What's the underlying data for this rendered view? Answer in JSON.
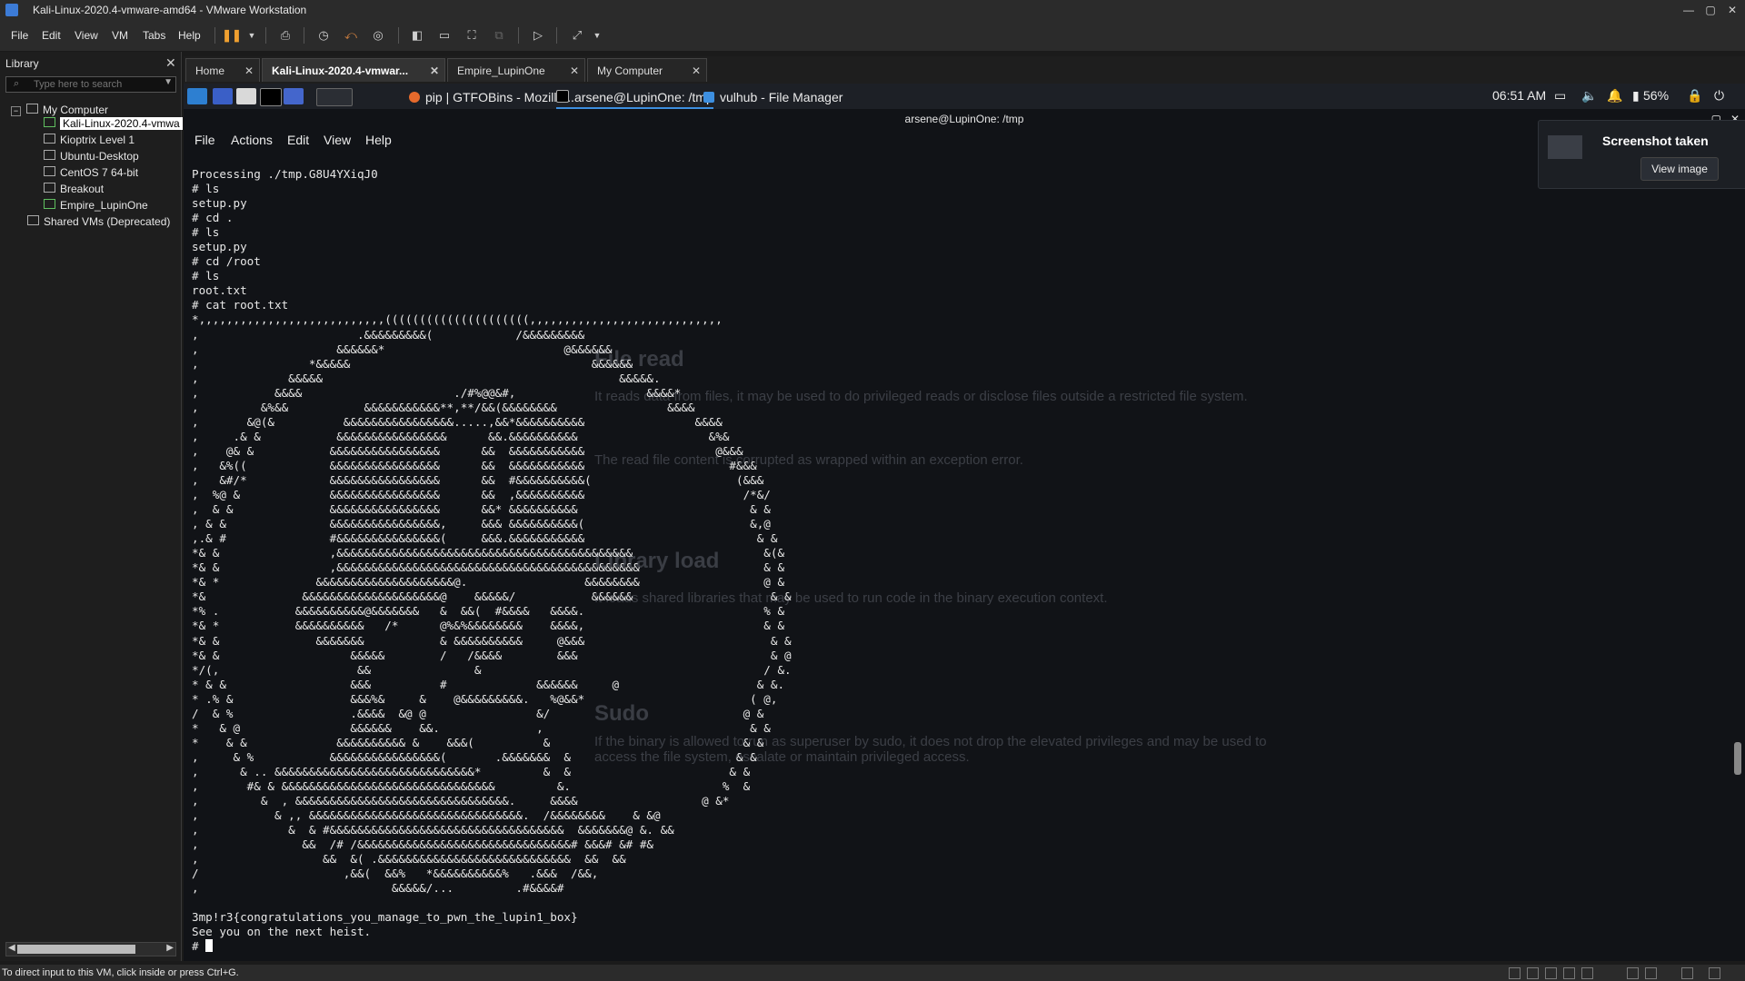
{
  "window": {
    "title": "Kali-Linux-2020.4-vmware-amd64 - VMware Workstation",
    "controls": {
      "minimize": "—",
      "maximize": "▢",
      "close": "✕"
    }
  },
  "menu": [
    "File",
    "Edit",
    "View",
    "VM",
    "Tabs",
    "Help"
  ],
  "library": {
    "title": "Library",
    "search_placeholder": "Type here to search",
    "tree": {
      "root": "My Computer",
      "vms": [
        "Kali-Linux-2020.4-vmwa",
        "Kioptrix Level 1",
        "Ubuntu-Desktop",
        "CentOS 7 64-bit",
        "Breakout",
        "Empire_LupinOne"
      ],
      "shared": "Shared VMs (Deprecated)"
    }
  },
  "tabs": [
    {
      "label": "Home",
      "active": false
    },
    {
      "label": "Kali-Linux-2020.4-vmwar...",
      "active": true
    },
    {
      "label": "Empire_LupinOne",
      "active": false
    },
    {
      "label": "My Computer",
      "active": false
    }
  ],
  "guest_panel": {
    "tasks": [
      "pip | GTFOBins - Mozilla...",
      "arsene@LupinOne: /tmp",
      "vulhub - File Manager"
    ],
    "clock": "06:51 AM",
    "battery": "56%"
  },
  "terminal": {
    "title": "arsene@LupinOne: /tmp",
    "menu": [
      "File",
      "Actions",
      "Edit",
      "View",
      "Help"
    ],
    "lines": [
      "Processing ./tmp.G8U4YXiqJ0",
      "# ls",
      "setup.py",
      "# cd .",
      "# ls",
      "setup.py",
      "# cd /root",
      "# ls",
      "root.txt",
      "# cat root.txt",
      "*,,,,,,,,,,,,,,,,,,,,,,,,,,,(((((((((((((((((((((,,,,,,,,,,,,,,,,,,,,,,,,,,,,",
      ",                       .&&&&&&&&&(            /&&&&&&&&&",
      ",                    &&&&&&*                          @&&&&&&",
      ",                *&&&&&                                   &&&&&&",
      ",             &&&&&                                           &&&&&.",
      ",           &&&&                      ./#%@@&#,                   &&&&*",
      ",         &%&&           &&&&&&&&&&&**,**/&&(&&&&&&&&                &&&&",
      ",       &@(&          &&&&&&&&&&&&&&&&.....,&&*&&&&&&&&&&                &&&&",
      ",     .& &           &&&&&&&&&&&&&&&&      &&.&&&&&&&&&&                   &%&",
      ",    @& &           &&&&&&&&&&&&&&&&      &&  &&&&&&&&&&&                   @&&&",
      ",   &%((            &&&&&&&&&&&&&&&&      &&  &&&&&&&&&&&                     #&&&",
      ",   &#/*            &&&&&&&&&&&&&&&&      &&  #&&&&&&&&&&(                     (&&&",
      ",  %@ &             &&&&&&&&&&&&&&&&      &&  ,&&&&&&&&&&                       /*&/",
      ",  & &              &&&&&&&&&&&&&&&&      &&* &&&&&&&&&&                         & &",
      ", & &               &&&&&&&&&&&&&&&&,     &&& &&&&&&&&&&(                        &,@",
      ",.& #               #&&&&&&&&&&&&&&&(     &&&.&&&&&&&&&&&                         & &",
      "*& &                ,&&&&&&&&&&&&&&&&&&&&&&&&&&&&&&&&&&&&&&&&&&&                   &(&",
      "*& &                ,&&&&&&&&&&&&&&&&&&&&&&&&&&&&&&&&&&&&&&&&&&&&                  & &",
      "*& *              &&&&&&&&&&&&&&&&&&&&@.                 &&&&&&&&                  @ &",
      "*&              &&&&&&&&&&&&&&&&&&&&@    &&&&&/           &&&&&&                    & &",
      "*% .           &&&&&&&&&&@&&&&&&&   &  &&(  #&&&&   &&&&.                          % &",
      "*& *           &&&&&&&&&&   /*      @%&%&&&&&&&&    &&&&,                          & &",
      "*& &              &&&&&&&           & &&&&&&&&&&     @&&&                           & &",
      "*& &                   &&&&&        /   /&&&&        &&&                            & @",
      "*/(,                    &&               &                                         / &.",
      "* & &                  &&&          #             &&&&&&     @                    & &.",
      "* .% &                 &&&%&     &    @&&&&&&&&&.   %@&&*                        ( @,",
      "/  & %                 .&&&&  &@ @                &/                            @ &",
      "*   & @                &&&&&&    &&.              ,                              & &",
      "*    & &             &&&&&&&&&& &    &&&(          &                            & &",
      ",     & %           &&&&&&&&&&&&&&&&(       .&&&&&&&  &                        & &",
      ",      & .. &&&&&&&&&&&&&&&&&&&&&&&&&&&&&*         &  &                       & &",
      ",       #& & &&&&&&&&&&&&&&&&&&&&&&&&&&&&&&&         &.                      %  &",
      ",         &  , &&&&&&&&&&&&&&&&&&&&&&&&&&&&&&&.     &&&&                  @ &*",
      ",           & ,, &&&&&&&&&&&&&&&&&&&&&&&&&&&&&&&.  /&&&&&&&&    & &@",
      ",             &  & #&&&&&&&&&&&&&&&&&&&&&&&&&&&&&&&&&&  &&&&&&&@ &. &&",
      ",               &&  /# /&&&&&&&&&&&&&&&&&&&&&&&&&&&&&&&# &&&# &# #&",
      ",                  &&  &( .&&&&&&&&&&&&&&&&&&&&&&&&&&&&  &&  &&",
      "/                     ,&&(  &&%   *&&&&&&&&&&%   .&&&  /&&,",
      ",                            &&&&&/...         .#&&&&#",
      "",
      "3mp!r3{congratulations_you_manage_to_pwn_the_lupin1_box}",
      "See you on the next heist.",
      "# "
    ]
  },
  "notification": {
    "title": "Screenshot taken",
    "button": "View image"
  },
  "background_page": {
    "headings": [
      "File read",
      "Library load",
      "Sudo"
    ],
    "paragraphs": [
      "It reads data from files, it may be used to do privileged reads or disclose files outside a restricted file system.",
      "The read file content is corrupted as wrapped within an exception error.",
      "It loads shared libraries that may be used to run code in the binary execution context.",
      "If the binary is allowed to run as superuser by sudo, it does not drop the elevated privileges and may be used to access the file system, escalate or maintain privileged access."
    ]
  },
  "statusbar": {
    "message": "To direct input to this VM, click inside or press Ctrl+G."
  }
}
